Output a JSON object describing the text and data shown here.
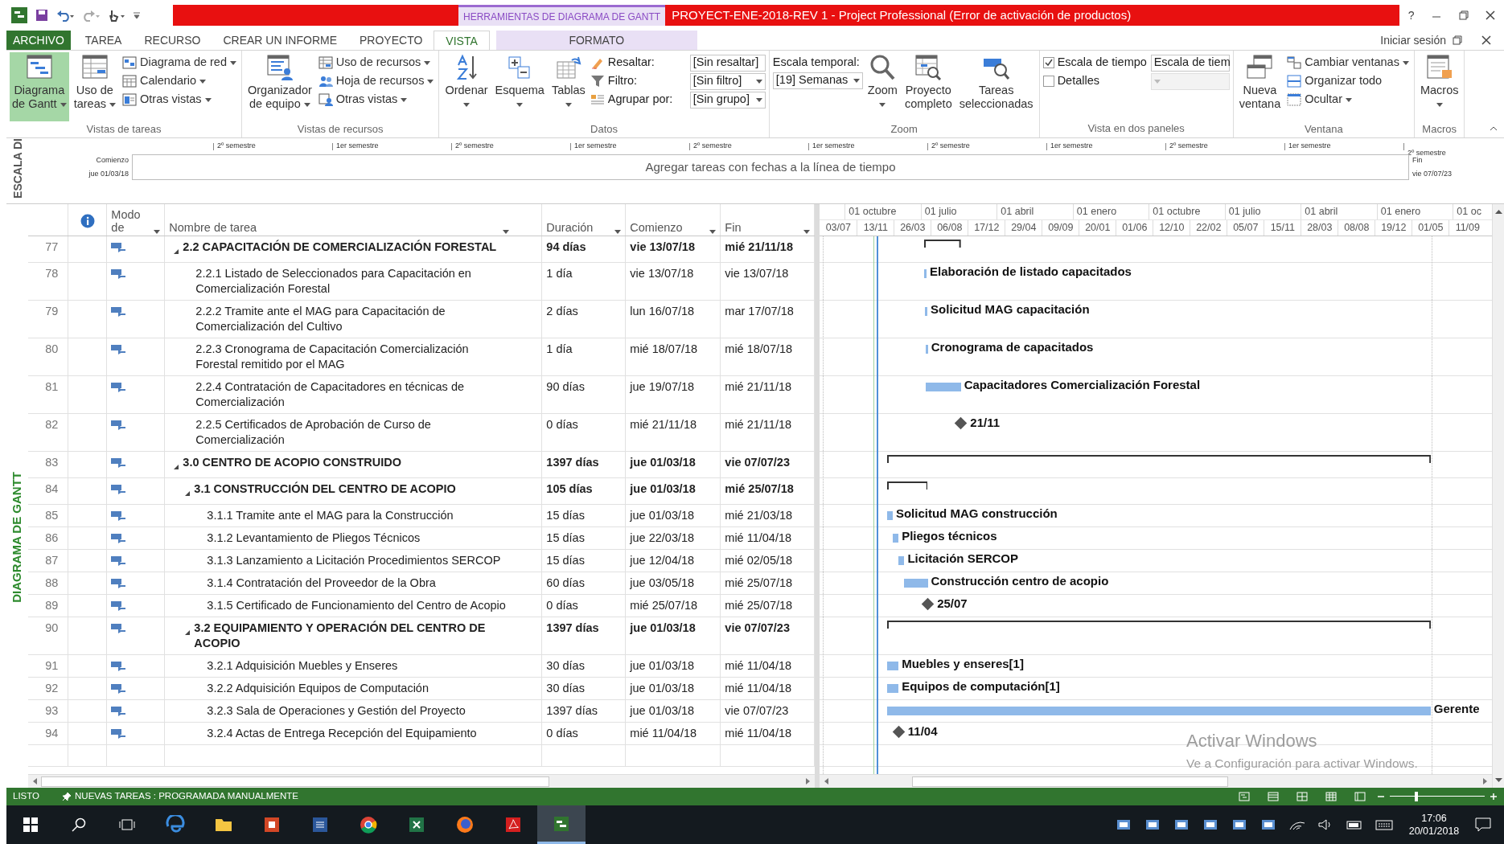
{
  "window": {
    "title": "PROYECT-ENE-2018-REV 1 -  Project Professional (Error de activación de productos)",
    "context_group": "HERRAMIENTAS DE DIAGRAMA DE GANTT",
    "help": "?"
  },
  "ribbon_tabs": [
    {
      "label": "ARCHIVO",
      "kind": "file",
      "selected": false
    },
    {
      "label": "TAREA",
      "kind": "tab",
      "selected": false
    },
    {
      "label": "RECURSO",
      "kind": "tab",
      "selected": false
    },
    {
      "label": "CREAR UN INFORME",
      "kind": "tab",
      "selected": false
    },
    {
      "label": "PROYECTO",
      "kind": "tab",
      "selected": false
    },
    {
      "label": "VISTA",
      "kind": "tab",
      "selected": true
    },
    {
      "label": "FORMATO",
      "kind": "context",
      "selected": false
    }
  ],
  "account": "Iniciar sesión",
  "ribbon_groups": [
    {
      "title": "Vistas de tareas",
      "items": [
        {
          "kind": "large",
          "lines": [
            "Diagrama",
            "de Gantt"
          ],
          "dropdown": true,
          "selected": true
        },
        {
          "kind": "large",
          "lines": [
            "Uso de",
            "tareas"
          ],
          "dropdown": true,
          "selected": false
        },
        {
          "kind": "small",
          "label": "Diagrama de red",
          "dropdown": true
        },
        {
          "kind": "small",
          "label": "Calendario",
          "dropdown": true
        },
        {
          "kind": "small",
          "label": "Otras vistas",
          "dropdown": true
        }
      ]
    },
    {
      "title": "Vistas de recursos",
      "items": [
        {
          "kind": "large",
          "lines": [
            "Organizador",
            "de equipo"
          ],
          "dropdown": true,
          "selected": false
        },
        {
          "kind": "small",
          "label": "Uso de recursos",
          "dropdown": true
        },
        {
          "kind": "small",
          "label": "Hoja de recursos",
          "dropdown": true
        },
        {
          "kind": "small",
          "label": "Otras vistas",
          "dropdown": true
        }
      ]
    },
    {
      "title": "Datos",
      "items": [
        {
          "kind": "large",
          "lines": [
            "Ordenar"
          ],
          "dropdown": true,
          "selected": false
        },
        {
          "kind": "large",
          "lines": [
            "Esquema"
          ],
          "dropdown": true,
          "selected": false
        },
        {
          "kind": "large",
          "lines": [
            "Tablas"
          ],
          "dropdown": true,
          "selected": false
        },
        {
          "kind": "combo",
          "label": "Resaltar:",
          "value": "[Sin resaltar]"
        },
        {
          "kind": "combo",
          "label": "Filtro:",
          "value": "[Sin filtro]"
        },
        {
          "kind": "combo",
          "label": "Agrupar por:",
          "value": "[Sin grupo]"
        }
      ]
    },
    {
      "title": "Zoom",
      "items": [
        {
          "kind": "stacked_combo",
          "label": "Escala temporal:",
          "value": "[19] Semanas"
        },
        {
          "kind": "large",
          "lines": [
            "Zoom"
          ],
          "dropdown": true,
          "selected": false
        },
        {
          "kind": "large",
          "lines": [
            "Proyecto",
            "completo"
          ],
          "dropdown": false,
          "selected": false
        },
        {
          "kind": "large",
          "lines": [
            "Tareas",
            "seleccionadas"
          ],
          "dropdown": false,
          "selected": false
        }
      ]
    },
    {
      "title": "Vista en dos paneles",
      "items": [
        {
          "kind": "check",
          "label": "Escala de tiempo",
          "checked": true,
          "value": "Escala de tiem",
          "disabled": false
        },
        {
          "kind": "check",
          "label": "Detalles",
          "checked": false,
          "disabled": true
        }
      ]
    },
    {
      "title": "Ventana",
      "items": [
        {
          "kind": "large",
          "lines": [
            "Nueva",
            "ventana"
          ],
          "dropdown": false,
          "selected": false
        },
        {
          "kind": "small",
          "label": "Cambiar ventanas",
          "dropdown": true
        },
        {
          "kind": "small",
          "label": "Organizar todo",
          "dropdown": false
        },
        {
          "kind": "small",
          "label": "Ocultar",
          "dropdown": true
        }
      ]
    },
    {
      "title": "Macros",
      "items": [
        {
          "kind": "large",
          "lines": [
            "Macros"
          ],
          "dropdown": true,
          "selected": false
        }
      ]
    }
  ],
  "timeline": {
    "label": "ESCALA DI",
    "ticks": [
      "2º semestre",
      "1er semestre",
      "2º semestre",
      "1er semestre",
      "2º semestre",
      "1er semestre",
      "2º semestre",
      "1er semestre",
      "2º semestre",
      "1er semestre"
    ],
    "end_tick": "2º semestre",
    "start_label": "Comienzo",
    "start": "jue 01/03/18",
    "end_label": "Fin",
    "end": "vie 07/07/23",
    "placeholder": "Agregar tareas con fechas a la línea de tiempo"
  },
  "side_label": "DIAGRAMA DE GANTT",
  "columns": [
    "Modo de",
    "Nombre de tarea",
    "Duración",
    "Comienzo",
    "Fin"
  ],
  "gantt": {
    "major_ticks": [
      "01 octubre",
      "01 julio",
      "01 abril",
      "01 enero",
      "01 octubre",
      "01 julio",
      "01 abril",
      "01 enero",
      "01 oc"
    ],
    "minor_ticks": [
      "03/07",
      "13/11",
      "26/03",
      "06/08",
      "17/12",
      "29/04",
      "09/09",
      "20/01",
      "01/06",
      "12/10",
      "22/02",
      "05/07",
      "15/11",
      "28/03",
      "08/08",
      "19/12",
      "01/05",
      "11/09"
    ]
  },
  "tasks": [
    {
      "id": "77",
      "name": "2.2 CAPACITACIÓN DE COMERCIALIZACIÓN FORESTAL",
      "duration": "94 días",
      "start": "vie 13/07/18",
      "finish": "mié 21/11/18",
      "expanded": true,
      "bar": {
        "kind": "summary"
      },
      "children": [
        {
          "id": "78",
          "name": "2.2.1 Listado de Seleccionados para Capacitación en Comercialización Forestal",
          "duration": "1 día",
          "start": "vie 13/07/18",
          "finish": "vie 13/07/18",
          "bar": {
            "kind": "task",
            "label": "Elaboración de listado capacitados"
          }
        },
        {
          "id": "79",
          "name": "2.2.2 Tramite ante el MAG para Capacitación de Comercialización del Cultivo",
          "duration": "2 días",
          "start": "lun 16/07/18",
          "finish": "mar 17/07/18",
          "bar": {
            "kind": "task",
            "label": "Solicitud MAG capacitación"
          }
        },
        {
          "id": "80",
          "name": "2.2.3 Cronograma de Capacitación Comercialización Forestal remitido por el MAG",
          "duration": "1 día",
          "start": "mié 18/07/18",
          "finish": "mié 18/07/18",
          "bar": {
            "kind": "task",
            "label": "Cronograma de capacitados"
          }
        },
        {
          "id": "81",
          "name": "2.2.4 Contratación de Capacitadores en técnicas de Comercialización",
          "duration": "90 días",
          "start": "jue 19/07/18",
          "finish": "mié 21/11/18",
          "bar": {
            "kind": "task",
            "label": "Capacitadores Comercialización Forestal"
          }
        },
        {
          "id": "82",
          "name": "2.2.5 Certificados de Aprobación de Curso de Comercialización",
          "duration": "0 días",
          "start": "mié 21/11/18",
          "finish": "mié 21/11/18",
          "bar": {
            "kind": "milestone",
            "label": "21/11"
          }
        }
      ]
    },
    {
      "id": "83",
      "name": "3.0 CENTRO DE ACOPIO CONSTRUIDO",
      "duration": "1397 días",
      "start": "jue 01/03/18",
      "finish": "vie 07/07/23",
      "expanded": true,
      "bar": {
        "kind": "summary"
      },
      "children": [
        {
          "id": "84",
          "name": "3.1 CONSTRUCCIÓN DEL CENTRO DE ACOPIO",
          "duration": "105 días",
          "start": "jue 01/03/18",
          "finish": "mié 25/07/18",
          "expanded": true,
          "bar": {
            "kind": "summary"
          },
          "children": [
            {
              "id": "85",
              "name": "3.1.1 Tramite ante el MAG para la Construcción",
              "duration": "15 días",
              "start": "jue 01/03/18",
              "finish": "mié 21/03/18",
              "bar": {
                "kind": "task",
                "label": "Solicitud MAG construcción"
              }
            },
            {
              "id": "86",
              "name": "3.1.2 Levantamiento de Pliegos Técnicos",
              "duration": "15 días",
              "start": "jue 22/03/18",
              "finish": "mié 11/04/18",
              "bar": {
                "kind": "task",
                "label": "Pliegos técnicos"
              }
            },
            {
              "id": "87",
              "name": "3.1.3 Lanzamiento a Licitación Procedimientos SERCOP",
              "duration": "15 días",
              "start": "jue 12/04/18",
              "finish": "mié 02/05/18",
              "bar": {
                "kind": "task",
                "label": "Licitación SERCOP"
              }
            },
            {
              "id": "88",
              "name": "3.1.4 Contratación del Proveedor de la Obra",
              "duration": "60 días",
              "start": "jue 03/05/18",
              "finish": "mié 25/07/18",
              "bar": {
                "kind": "task",
                "label": "Construcción centro de acopio"
              }
            },
            {
              "id": "89",
              "name": "3.1.5 Certificado de Funcionamiento del Centro de Acopio",
              "duration": "0 días",
              "start": "mié 25/07/18",
              "finish": "mié 25/07/18",
              "bar": {
                "kind": "milestone",
                "label": "25/07"
              }
            }
          ]
        },
        {
          "id": "90",
          "name": "3.2 EQUIPAMIENTO  Y OPERACIÓN DEL CENTRO DE ACOPIO",
          "duration": "1397 días",
          "start": "jue 01/03/18",
          "finish": "vie 07/07/23",
          "expanded": true,
          "bar": {
            "kind": "summary"
          },
          "children": [
            {
              "id": "91",
              "name": "3.2.1 Adquisición Muebles y Enseres",
              "duration": "30 días",
              "start": "jue 01/03/18",
              "finish": "mié 11/04/18",
              "bar": {
                "kind": "task",
                "label": "Muebles y enseres[1]"
              }
            },
            {
              "id": "92",
              "name": "3.2.2 Adquisición Equipos de Computación",
              "duration": "30 días",
              "start": "jue 01/03/18",
              "finish": "mié 11/04/18",
              "bar": {
                "kind": "task",
                "label": "Equipos de computación[1]"
              }
            },
            {
              "id": "93",
              "name": "3.2.3 Sala de Operaciones y Gestión del Proyecto",
              "duration": "1397 días",
              "start": "jue 01/03/18",
              "finish": "vie 07/07/23",
              "bar": {
                "kind": "task",
                "label": "Gerente"
              }
            },
            {
              "id": "94",
              "name": "3.2.4 Actas de Entrega Recepción del Equipamiento",
              "duration": "0 días",
              "start": "mié 11/04/18",
              "finish": "mié 11/04/18",
              "bar": {
                "kind": "milestone",
                "label": "11/04"
              }
            }
          ]
        }
      ]
    }
  ],
  "activation": {
    "title": "Activar Windows",
    "text": "Ve a Configuración para activar Windows."
  },
  "status_bar": {
    "mode": "LISTO",
    "new_tasks": "NUEVAS TAREAS : PROGRAMADA MANUALMENTE",
    "zoom": {
      "level": 0.27
    }
  },
  "taskbar": {
    "apps": [
      {
        "selected": false
      },
      {
        "selected": false
      },
      {
        "selected": false
      },
      {
        "selected": false
      },
      {
        "selected": false
      },
      {
        "selected": false
      },
      {
        "selected": false
      },
      {
        "selected": false
      },
      {
        "selected": true
      }
    ],
    "time": "17:06",
    "date": "20/01/2018"
  }
}
